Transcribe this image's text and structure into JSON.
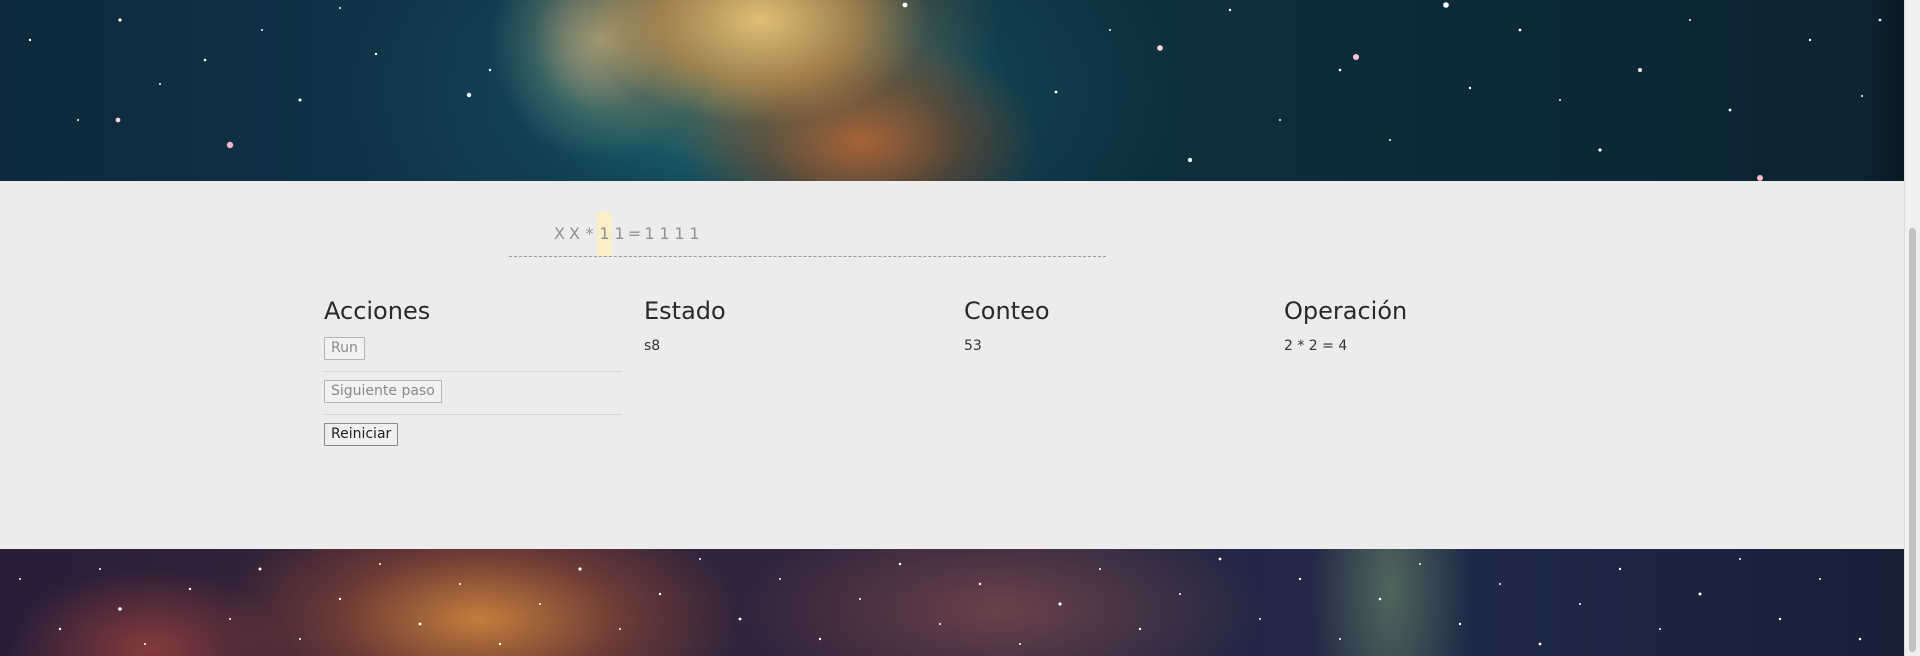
{
  "tape": {
    "cells": [
      "X",
      "X",
      "*",
      "1",
      "1",
      "=",
      "1",
      "1",
      "1",
      "1"
    ],
    "head_index": 3
  },
  "sections": {
    "acciones": {
      "title": "Acciones",
      "buttons": {
        "run": "Run",
        "next_step": "Siguiente paso",
        "reset": "Reiniciar"
      }
    },
    "estado": {
      "title": "Estado",
      "value": "s8"
    },
    "conteo": {
      "title": "Conteo",
      "value": "53"
    },
    "operacion": {
      "title": "Operación",
      "value": "2 * 2 = 4"
    }
  },
  "colors": {
    "background": "#ececec",
    "head_highlight": "#fbeec8",
    "tape_text": "#8f8f8f"
  }
}
